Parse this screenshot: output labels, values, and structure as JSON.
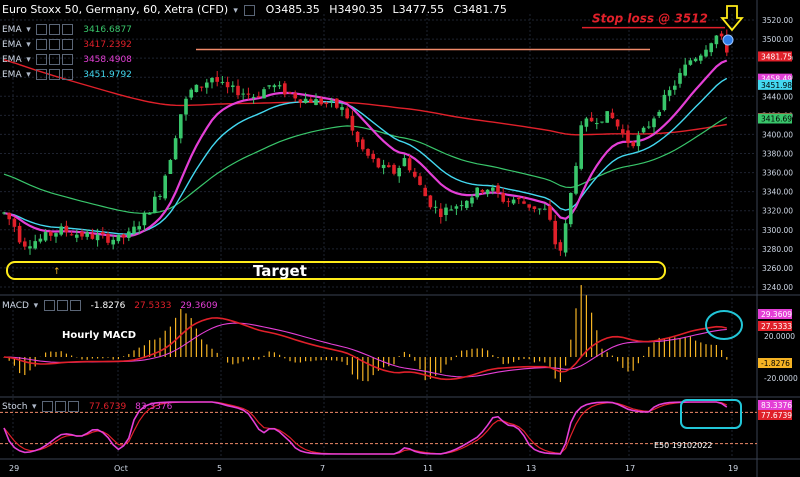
{
  "header": {
    "symbol": "Euro Stoxx 50, Germany, 60, Xetra (CFD)",
    "open": "O3485.35",
    "high": "H3490.35",
    "low": "L3477.55",
    "close": "C3481.75"
  },
  "indicators": [
    {
      "name": "EMA",
      "value": "3416.6877",
      "color": "#39c66b"
    },
    {
      "name": "EMA",
      "value": "3417.2392",
      "color": "#e0202a"
    },
    {
      "name": "EMA",
      "value": "3458.4908",
      "color": "#e43fd6"
    },
    {
      "name": "EMA",
      "value": "3451.9792",
      "color": "#43d8f0"
    }
  ],
  "annotations": {
    "stop_loss": "Stop loss @ 3512",
    "target": "Target",
    "hourly_macd": "Hourly MACD",
    "watermark": "E50 19102022"
  },
  "price_axis": {
    "ticks": [
      "3520.00",
      "3500.00",
      "3480.00",
      "3460.00",
      "3440.00",
      "3420.00",
      "3400.00",
      "3380.00",
      "3360.00",
      "3340.00",
      "3320.00",
      "3300.00",
      "3280.00",
      "3260.00",
      "3240.00"
    ],
    "badges": [
      {
        "value": "3481.75",
        "bg": "#e0202a",
        "fg": "#ffffff"
      },
      {
        "value": "3458.49",
        "bg": "#e43fd6",
        "fg": "#ffffff"
      },
      {
        "value": "3451.98",
        "bg": "#43d8f0",
        "fg": "#000000"
      },
      {
        "value": "3417.24",
        "bg": "#e0202a",
        "fg": "#ffffff"
      },
      {
        "value": "3416.69",
        "bg": "#39c66b",
        "fg": "#000000"
      }
    ]
  },
  "macd_pane": {
    "label": "MACD",
    "values": [
      "-1.8276",
      "27.5333",
      "29.3609"
    ],
    "ticks": [
      "20.0000",
      "-20.0000"
    ],
    "badges": [
      {
        "value": "29.3609",
        "bg": "#e43fd6",
        "fg": "#ffffff"
      },
      {
        "value": "27.5333",
        "bg": "#e0202a",
        "fg": "#ffffff"
      },
      {
        "value": "-1.8276",
        "bg": "#f5b324",
        "fg": "#000000"
      }
    ]
  },
  "stoch_pane": {
    "label": "Stoch",
    "values": [
      "77.6739",
      "83.3376"
    ],
    "badges": [
      {
        "value": "83.3376",
        "bg": "#e43fd6",
        "fg": "#ffffff"
      },
      {
        "value": "77.6739",
        "bg": "#e0202a",
        "fg": "#ffffff"
      }
    ]
  },
  "time_axis": {
    "labels": [
      "29",
      "Oct",
      "5",
      "7",
      "11",
      "13",
      "17",
      "19"
    ]
  },
  "colors": {
    "background": "#000000",
    "grid": "#1e2330",
    "candle_up": "#39c66b",
    "candle_down": "#e0202a",
    "ema_fast": "#43d8f0",
    "ema_mid": "#e43fd6",
    "ema_slow": "#39c66b",
    "ema_long": "#e0202a",
    "macd_hist": "#f5b324",
    "highlight": "#ffec1a",
    "circle": "#22c6d8",
    "resistance": "#f08a6a"
  }
}
